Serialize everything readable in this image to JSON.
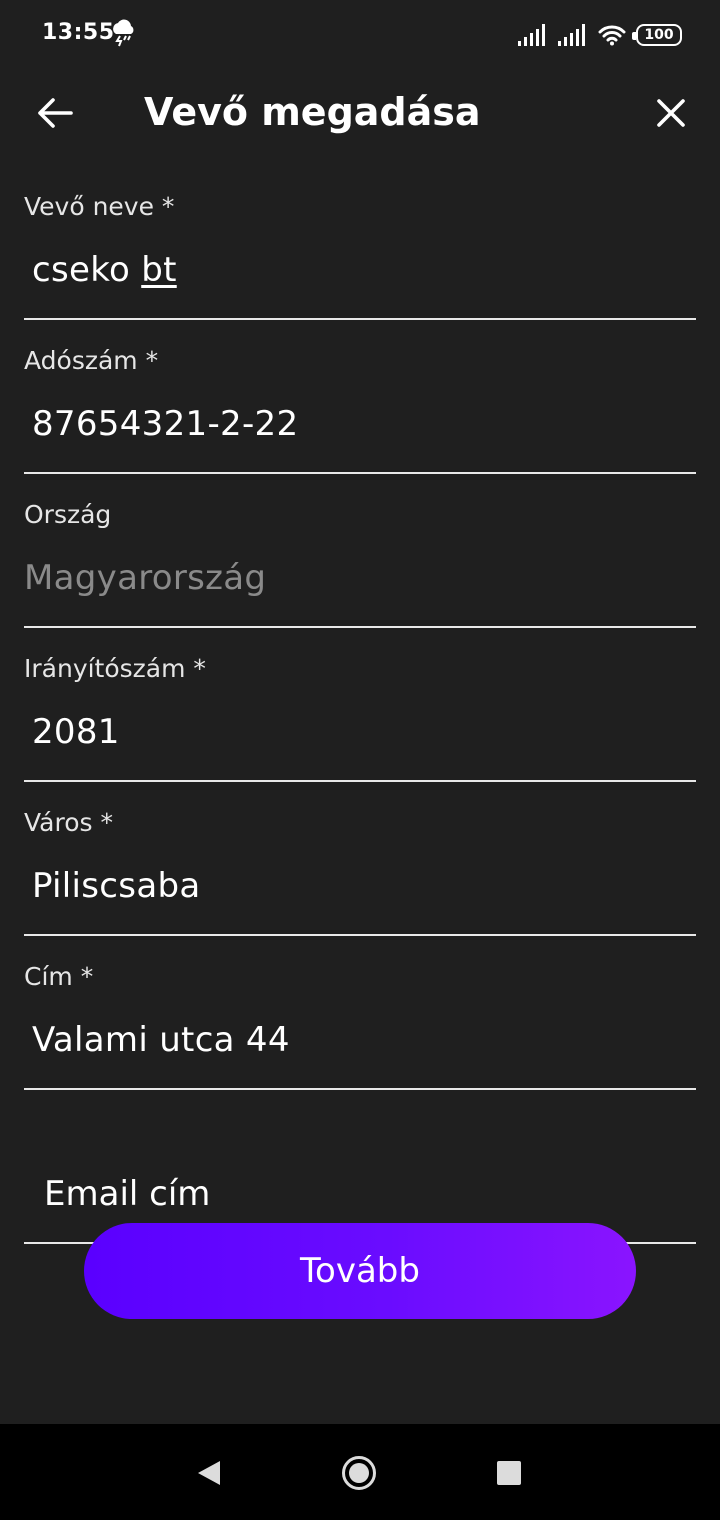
{
  "status_bar": {
    "time": "13:55",
    "weather_icon": "storm-cloud-icon",
    "battery_level": "100"
  },
  "header": {
    "title": "Vevő megadása",
    "back_icon": "arrow-left-icon",
    "close_icon": "close-icon"
  },
  "form": {
    "buyer_name": {
      "label": "Vevő neve *",
      "value_main": "cseko ",
      "value_underlined": "bt"
    },
    "tax_number": {
      "label": "Adószám *",
      "value": "87654321-2-22"
    },
    "country": {
      "label": "Ország",
      "value": "Magyarország"
    },
    "postal_code": {
      "label": "Irányítószám *",
      "value": "2081"
    },
    "city": {
      "label": "Város *",
      "value": "Piliscsaba"
    },
    "address": {
      "label": "Cím *",
      "value": "Valami utca 44"
    },
    "email": {
      "placeholder": "Email cím"
    }
  },
  "actions": {
    "next_label": "Tovább"
  },
  "colors": {
    "background": "#1f1f1f",
    "accent_start": "#5a00ff",
    "accent_end": "#8a14ff",
    "disabled_text": "#8a8a8a"
  }
}
